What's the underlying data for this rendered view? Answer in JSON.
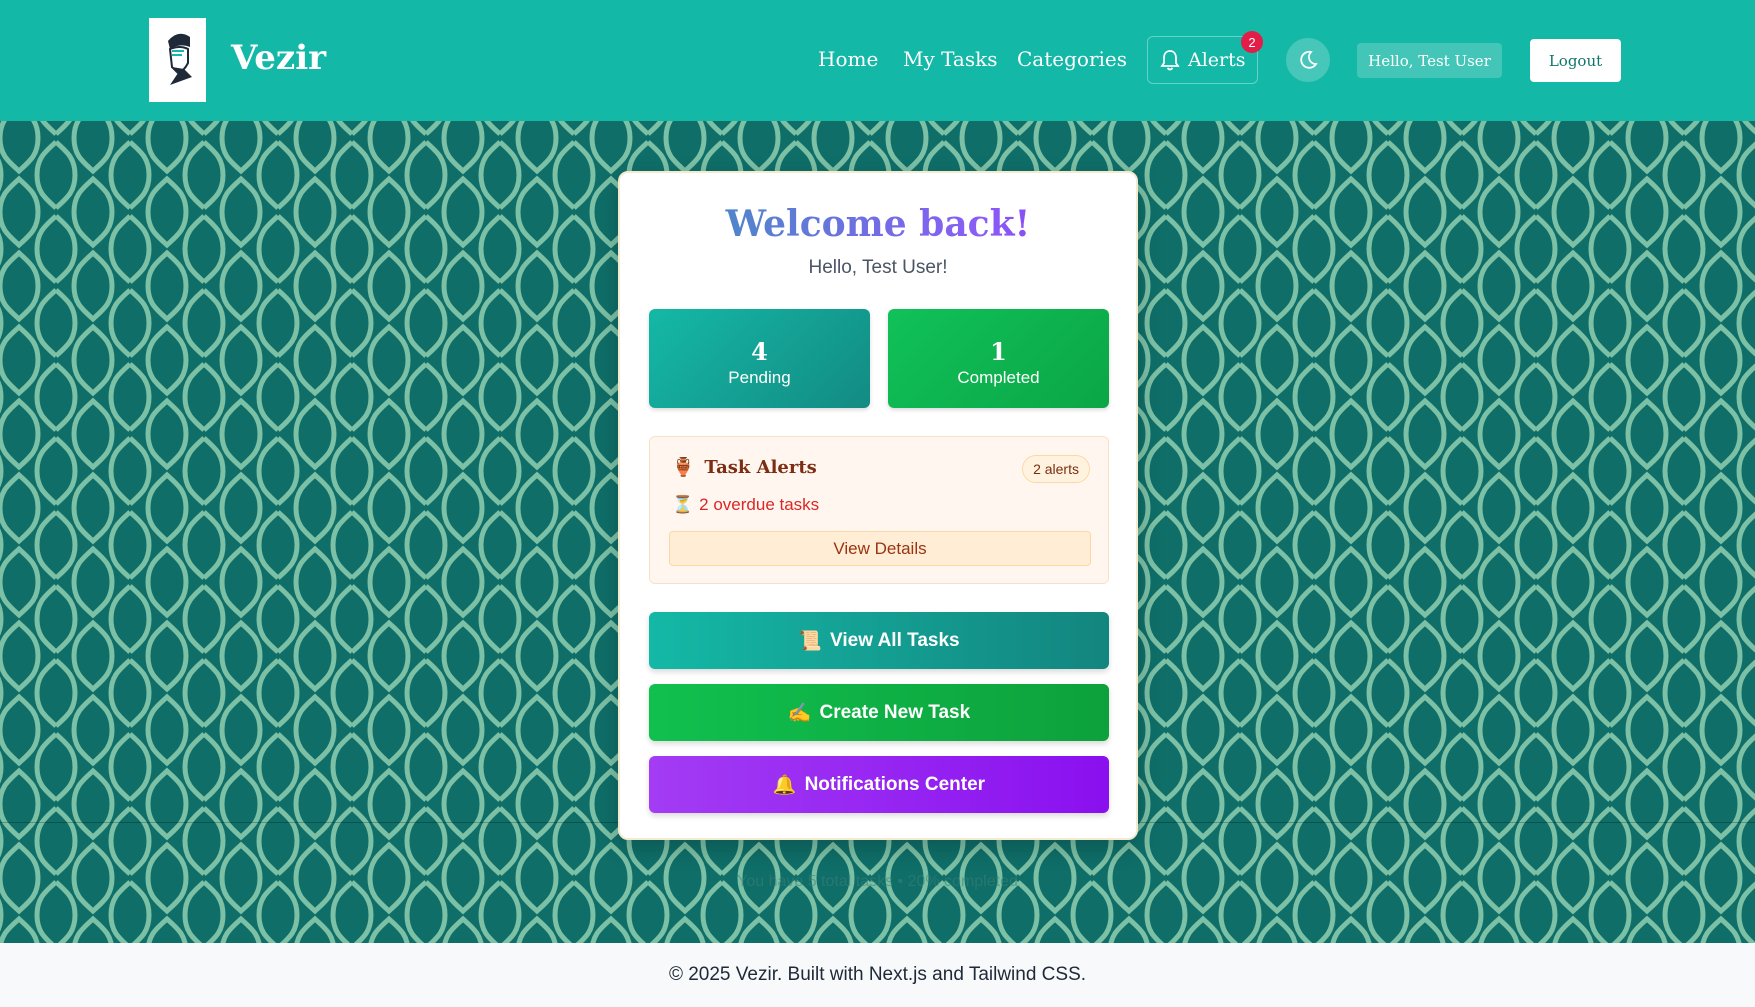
{
  "header": {
    "brand": "Vezir",
    "nav": [
      "Home",
      "My Tasks",
      "Categories"
    ],
    "alerts_label": "Alerts",
    "alerts_badge": "2",
    "greeting": "Hello, Test User",
    "logout_label": "Logout",
    "logo_icon": "vizier-portrait-icon",
    "theme_icon": "moon-icon"
  },
  "card": {
    "title": "Welcome back!",
    "subtitle": "Hello, Test User!",
    "stats": [
      {
        "value": "4",
        "label": "Pending"
      },
      {
        "value": "1",
        "label": "Completed"
      }
    ],
    "alerts": {
      "icon": "🏺",
      "title": "Task Alerts",
      "count": "2 alerts",
      "overdue_icon": "⏳",
      "overdue_text": "2 overdue tasks",
      "details_label": "View Details"
    },
    "actions": [
      {
        "icon": "📜",
        "label": "View All Tasks"
      },
      {
        "icon": "✍️",
        "label": "Create New Task"
      },
      {
        "icon": "🔔",
        "label": "Notifications Center"
      }
    ]
  },
  "summary": "You have 5 total tasks • 20% completed",
  "footer": "© 2025 Vezir. Built with Next.js and Tailwind CSS.",
  "colors": {
    "header_bg": "#14b8a6",
    "pattern_bg": "#0f6e68",
    "pattern_stroke": "#8fcfb0",
    "accent_purple": "#8b5cf6"
  }
}
